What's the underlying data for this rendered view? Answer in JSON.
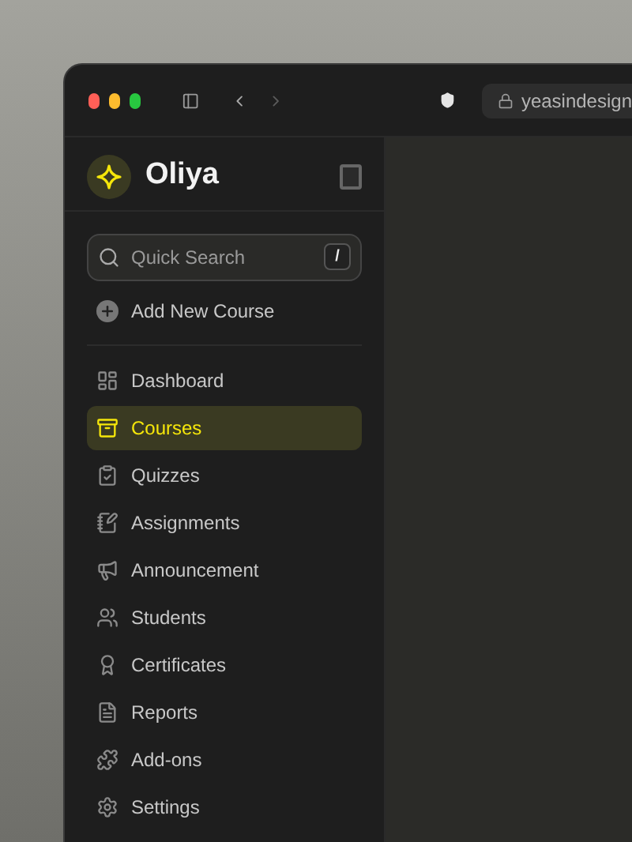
{
  "browser": {
    "url": "yeasindesign",
    "nav_buttons": [
      {
        "kind": "back",
        "disabled": false
      },
      {
        "kind": "forward",
        "disabled": true
      }
    ]
  },
  "sidebar": {
    "app_name": "Oliya",
    "search": {
      "placeholder": "Quick Search",
      "shortcut": "/"
    },
    "add_button": "Add New Course",
    "items": [
      {
        "label": "Dashboard",
        "selected": false
      },
      {
        "label": "Courses",
        "selected": true
      },
      {
        "label": "Quizzes",
        "selected": false
      },
      {
        "label": "Assignments",
        "selected": false
      },
      {
        "label": "Announcement",
        "selected": false
      },
      {
        "label": "Students",
        "selected": false
      },
      {
        "label": "Certificates",
        "selected": false
      },
      {
        "label": "Reports",
        "selected": false
      },
      {
        "label": "Add-ons",
        "selected": false
      },
      {
        "label": "Settings",
        "selected": false
      }
    ]
  }
}
